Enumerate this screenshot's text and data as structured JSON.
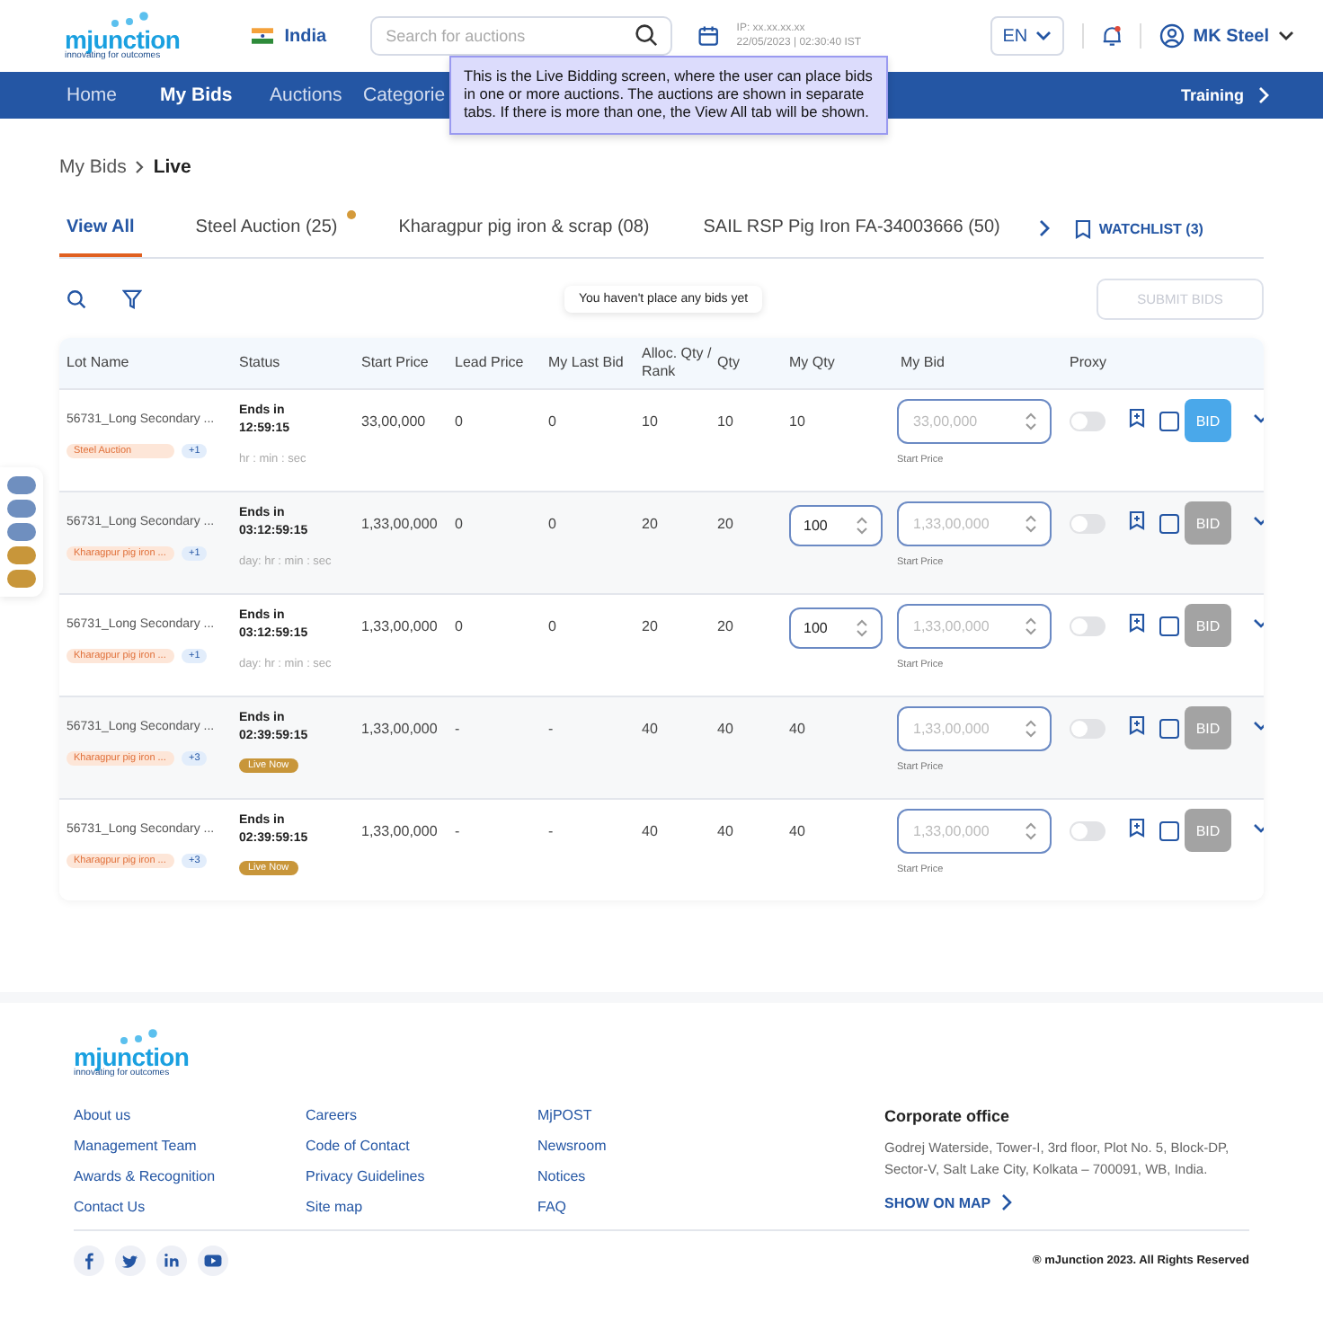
{
  "header": {
    "logo": "mjunction",
    "logo_tagline": "innovating for outcomes",
    "country": "India",
    "search": {
      "placeholder": "Search for auctions"
    },
    "ip": "IP: xx.xx.xx.xx",
    "datetime": "22/05/2023 | 02:30:40 IST",
    "language": "EN",
    "user": "MK Steel"
  },
  "nav": {
    "items": [
      {
        "label": "Home",
        "selected": false
      },
      {
        "label": "My Bids",
        "selected": true
      },
      {
        "label": "Auctions",
        "selected": false
      },
      {
        "label": "Categorie",
        "selected": false
      }
    ],
    "training": "Training"
  },
  "tooltip": "This is the Live Bidding screen, where the user can place bids in one or more auctions. The auctions are shown in separate tabs. If there is more than one, the View All tab will be shown.",
  "breadcrumb": [
    "My Bids",
    "Live"
  ],
  "tabs": [
    {
      "label": "View All",
      "selected": true,
      "notify": false
    },
    {
      "label": "Steel Auction (25)",
      "selected": false,
      "notify": true
    },
    {
      "label": "Kharagpur pig iron & scrap (08)",
      "selected": false,
      "notify": false
    },
    {
      "label": "SAIL RSP Pig Iron FA-34003666 (50)",
      "selected": false,
      "notify": false
    }
  ],
  "watchlist": "WATCHLIST (3)",
  "toast": "You haven't place any bids yet",
  "submit": {
    "label": "SUBMIT BIDS",
    "disabled": true
  },
  "columns": [
    "Lot Name",
    "Status",
    "Start Price",
    "Lead Price",
    "My Last Bid",
    "Alloc. Qty / Rank",
    "Qty",
    "My Qty",
    "My Bid",
    "Proxy"
  ],
  "rows": [
    {
      "lot": "56731_Long Secondary ...",
      "tag": "Steel Auction",
      "more": "+1",
      "ends": "Ends in",
      "time": "12:59:15",
      "note": {
        "kind": "hint",
        "text": "hr : min : sec"
      },
      "start_price": "33,00,000",
      "lead_price": "0",
      "last_bid": "0",
      "alloc": "10",
      "qty": "10",
      "my_qty": {
        "kind": "text",
        "value": "10"
      },
      "bid_placeholder": "33,00,000",
      "bid_hint": "Start Price",
      "proxy_on": false,
      "checked": false,
      "bid": {
        "label": "BID",
        "disabled": false
      }
    },
    {
      "lot": "56731_Long Secondary ...",
      "tag": "Kharagpur pig iron ...",
      "more": "+1",
      "ends": "Ends in",
      "time": "03:12:59:15",
      "note": {
        "kind": "hint",
        "text": "day: hr : min : sec"
      },
      "start_price": "1,33,00,000",
      "lead_price": "0",
      "last_bid": "0",
      "alloc": "20",
      "qty": "20",
      "my_qty": {
        "kind": "input",
        "value": "100"
      },
      "bid_placeholder": "1,33,00,000",
      "bid_hint": "Start Price",
      "proxy_on": false,
      "checked": false,
      "bid": {
        "label": "BID",
        "disabled": true
      }
    },
    {
      "lot": "56731_Long Secondary ...",
      "tag": "Kharagpur pig iron ...",
      "more": "+1",
      "ends": "Ends in",
      "time": "03:12:59:15",
      "note": {
        "kind": "hint",
        "text": "day: hr : min : sec"
      },
      "start_price": "1,33,00,000",
      "lead_price": "0",
      "last_bid": "0",
      "alloc": "20",
      "qty": "20",
      "my_qty": {
        "kind": "input",
        "value": "100"
      },
      "bid_placeholder": "1,33,00,000",
      "bid_hint": "Start Price",
      "proxy_on": false,
      "checked": false,
      "bid": {
        "label": "BID",
        "disabled": true
      }
    },
    {
      "lot": "56731_Long Secondary ...",
      "tag": "Kharagpur pig iron ...",
      "more": "+3",
      "ends": "Ends in",
      "time": "02:39:59:15",
      "note": {
        "kind": "badge",
        "text": "Live Now"
      },
      "start_price": "1,33,00,000",
      "lead_price": "-",
      "last_bid": "-",
      "alloc": "40",
      "qty": "40",
      "my_qty": {
        "kind": "text",
        "value": "40"
      },
      "bid_placeholder": "1,33,00,000",
      "bid_hint": "Start Price",
      "proxy_on": false,
      "checked": false,
      "bid": {
        "label": "BID",
        "disabled": true
      }
    },
    {
      "lot": "56731_Long Secondary ...",
      "tag": "Kharagpur pig iron ...",
      "more": "+3",
      "ends": "Ends in",
      "time": "02:39:59:15",
      "note": {
        "kind": "badge",
        "text": "Live Now"
      },
      "start_price": "1,33,00,000",
      "lead_price": "-",
      "last_bid": "-",
      "alloc": "40",
      "qty": "40",
      "my_qty": {
        "kind": "text",
        "value": "40"
      },
      "bid_placeholder": "1,33,00,000",
      "bid_hint": "Start Price",
      "proxy_on": false,
      "checked": false,
      "bid": {
        "label": "BID",
        "disabled": true
      }
    }
  ],
  "side_markers": [
    {
      "color": "#6f8fbf"
    },
    {
      "color": "#6f8fbf"
    },
    {
      "color": "#6f8fbf"
    },
    {
      "color": "#c8963a"
    },
    {
      "color": "#c8963a"
    }
  ],
  "footer": {
    "logo": "mjunction",
    "logo_tagline": "innovating for outcomes",
    "link_columns": [
      [
        "About us",
        "Management Team",
        "Awards & Recognition",
        "Contact Us"
      ],
      [
        "Careers",
        "Code of Contact",
        "Privacy Guidelines",
        "Site map"
      ],
      [
        "MjPOST",
        "Newsroom",
        "Notices",
        "FAQ"
      ]
    ],
    "office_title": "Corporate office",
    "office_address": "Godrej Waterside, Tower-I, 3rd floor, Plot No. 5, Block-DP, Sector-V, Salt Lake City, Kolkata – 700091, WB, India.",
    "map_link": "SHOW ON MAP",
    "copyright": "® mJunction 2023. All Rights Reserved"
  }
}
